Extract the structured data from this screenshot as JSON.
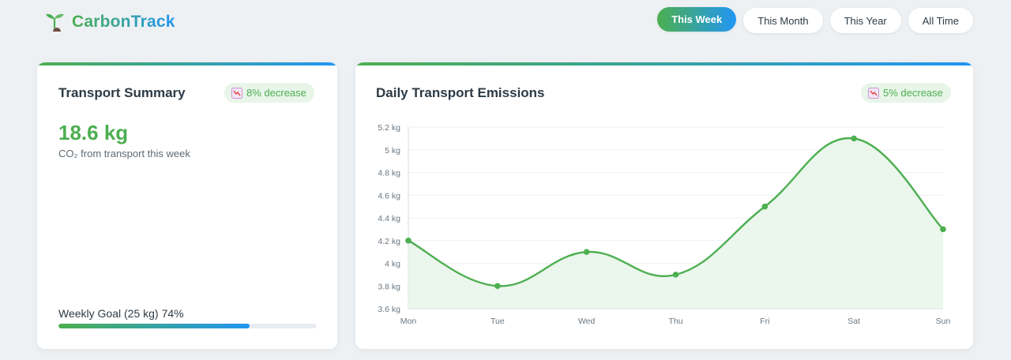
{
  "app": {
    "name": "CarbonTrack"
  },
  "filters": [
    {
      "label": "This Week",
      "active": true
    },
    {
      "label": "This Month",
      "active": false
    },
    {
      "label": "This Year",
      "active": false
    },
    {
      "label": "All Time",
      "active": false
    }
  ],
  "summary": {
    "title": "Transport Summary",
    "badge": "8% decrease",
    "badge_icon": "trend-down-icon",
    "value": "18.6 kg",
    "subtitle": "CO₂ from transport this week",
    "goal_label": "Weekly Goal (25 kg)",
    "goal_percent_label": "74%",
    "goal_progress": 0.74
  },
  "emissions_card": {
    "title": "Daily Transport Emissions",
    "badge": "5% decrease",
    "badge_icon": "trend-down-icon"
  },
  "colors": {
    "accent_green": "#4caf50",
    "accent_blue": "#2196f3",
    "fill_green": "#e8f5e9"
  },
  "chart_data": {
    "type": "area",
    "title": "",
    "xlabel": "",
    "ylabel": "",
    "categories": [
      "Mon",
      "Tue",
      "Wed",
      "Thu",
      "Fri",
      "Sat",
      "Sun"
    ],
    "series": [
      {
        "values": [
          4.2,
          3.8,
          4.1,
          3.9,
          4.5,
          5.1,
          4.3
        ]
      }
    ],
    "ylim": [
      3.6,
      5.2
    ],
    "yticks": [
      3.6,
      3.8,
      4,
      4.2,
      4.4,
      4.6,
      4.8,
      5,
      5.2
    ],
    "ytick_suffix": " kg",
    "grid": true,
    "legend": "none"
  }
}
